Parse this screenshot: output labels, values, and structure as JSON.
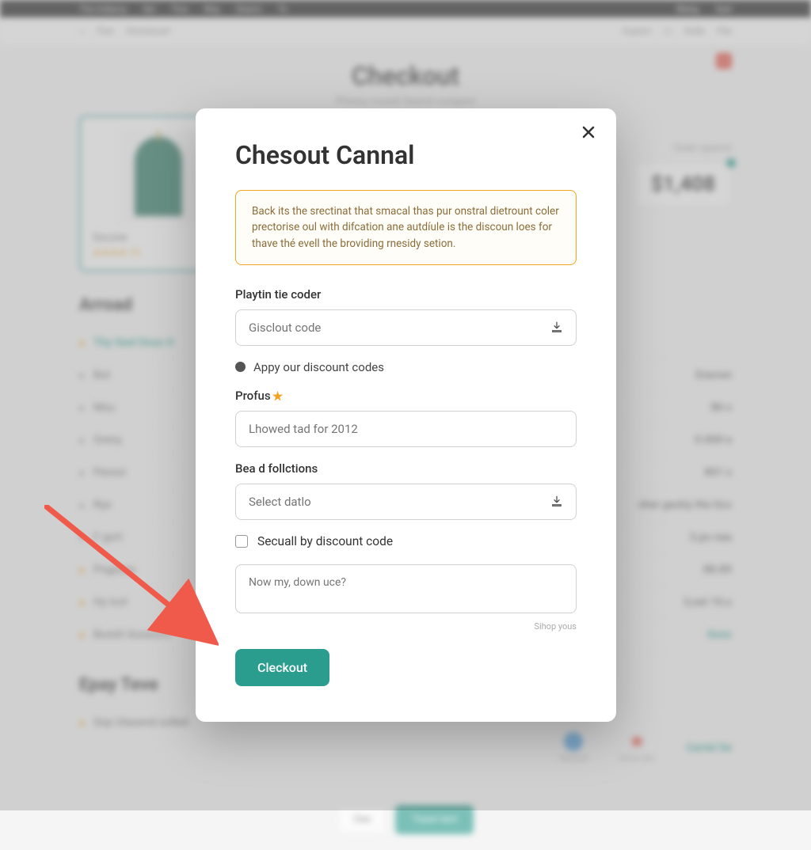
{
  "topbar": {
    "brand": "The Indiamy",
    "nav": [
      "Set",
      "Tine",
      "Wey",
      "Sisenn",
      "Te"
    ],
    "right": [
      "Blelay",
      "Seel"
    ]
  },
  "header": {
    "crumbs": [
      "Fles",
      "Direckssel"
    ],
    "right": [
      "Supect",
      "Delle",
      "File"
    ]
  },
  "page": {
    "title": "Checkout",
    "subtitle": "Plisiny nssed Sasnd sungest",
    "close_badge": "×"
  },
  "product": {
    "name": "Socone",
    "rating": "★★★★ 10"
  },
  "side": {
    "label": "Ooler opennt",
    "price": "$1,408"
  },
  "section": "Arroad",
  "rows": [
    {
      "label": "Thy Seel Doss It",
      "value": "",
      "highlight": true,
      "dot": "orange"
    },
    {
      "label": "But",
      "value": "Esecon"
    },
    {
      "label": "Msu",
      "value": "86 s"
    },
    {
      "label": "Greny",
      "value": "0.000 e"
    },
    {
      "label": "Pesssi",
      "value": "801 s"
    },
    {
      "label": "Rye",
      "value": "sher geshy the tics"
    },
    {
      "label": "F gort",
      "value": "3.ps naa"
    },
    {
      "label": "Pngsces",
      "value": "88.89",
      "dot": "orange"
    },
    {
      "label": "Hy Icol",
      "value": "3,set 10.s",
      "dot": "orange"
    },
    {
      "label": "Bunsh Sussrors",
      "value": "Suns",
      "dot": "orange",
      "highlight_val": true
    }
  ],
  "footer": {
    "section": "Epay Teve",
    "row_label": "Sop Utasend solled",
    "icons": [
      {
        "name": "Sommd",
        "color": "#4fa3e3"
      },
      {
        "name": "Sonrs late",
        "color": "#e74c3c"
      },
      {
        "name": "Cartel Se",
        "color": "#2a9d8f",
        "text": true
      }
    ],
    "btn_secondary": "See",
    "btn_primary": "Toest lent"
  },
  "modal": {
    "title": "Chesout Cannal",
    "alert": "Back its the srectinat that smacal thas pur onstral dietrount coler prectorise oul with difcation ane autdíule is the discoun loes for thave thé evell the broviding rnesidy setion.",
    "coder_label": "Playtin tie coder",
    "coder_placeholder": "Gisclout code",
    "radio_label": "Appy our discount codes",
    "profus_label": "Profus",
    "profus_placeholder": "Lhowed tad for 2012",
    "follctions_label": "Bea d follctions",
    "follctions_placeholder": "Select datlo",
    "checkbox_label": "Secuall by discount code",
    "textarea_placeholder": "Now my, down uce?",
    "helper": "Sihop yous",
    "submit": "Cleckout"
  }
}
